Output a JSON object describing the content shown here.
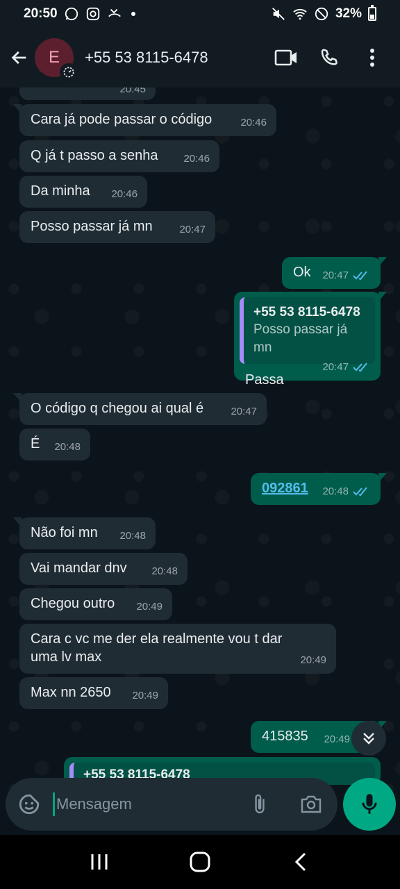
{
  "status_bar": {
    "time": "20:50",
    "battery": "32%",
    "icons": [
      "whatsapp-icon",
      "instagram-icon",
      "missed-call-icon",
      "mute-icon",
      "wifi-icon",
      "dnd-icon",
      "battery-icon"
    ]
  },
  "header": {
    "avatar_letter": "E",
    "contact_name": "+55 53 8115-6478",
    "actions": [
      "video-call-icon",
      "voice-call-icon",
      "more-options-icon"
    ]
  },
  "messages": [
    {
      "dir": "in",
      "text": "Cara já pode passar o código",
      "time": "20:46"
    },
    {
      "dir": "in",
      "text": "Q já t passo a senha",
      "time": "20:46"
    },
    {
      "dir": "in",
      "text": "Da minha",
      "time": "20:46"
    },
    {
      "dir": "in",
      "text": "Posso passar já mn",
      "time": "20:47"
    },
    {
      "dir": "out",
      "text": "Ok",
      "time": "20:47"
    },
    {
      "dir": "out",
      "reply_to_name": "+55 53 8115-6478",
      "reply_to_text": "Posso passar já mn",
      "text": "Passa",
      "time": "20:47"
    },
    {
      "dir": "in",
      "text": "O código q chegou ai qual é",
      "time": "20:47"
    },
    {
      "dir": "in",
      "text": "É",
      "time": "20:48"
    },
    {
      "dir": "out",
      "text": "092861",
      "time": "20:48"
    },
    {
      "dir": "in",
      "text": "Não foi mn",
      "time": "20:48"
    },
    {
      "dir": "in",
      "text": "Vai mandar dnv",
      "time": "20:48"
    },
    {
      "dir": "in",
      "text": "Chegou outro",
      "time": "20:49"
    },
    {
      "dir": "in",
      "text": "Cara c vc me der ela realmente vou t dar uma lv max",
      "time": "20:49"
    },
    {
      "dir": "in",
      "text": "Max nn 2650",
      "time": "20:49"
    },
    {
      "dir": "out",
      "text": "415835",
      "time": "20:49"
    },
    {
      "dir": "out",
      "reply_to_name": "+55 53 8115-6478",
      "text": ""
    }
  ],
  "partial_top_time": "20:45",
  "input": {
    "placeholder": "Mensagem"
  },
  "colors": {
    "background": "#0b141a",
    "incoming_bubble": "#202c33",
    "outgoing_bubble": "#005c4b",
    "accent": "#00a884",
    "read_ticks": "#53bdeb",
    "quote_bar": "#a78bfa"
  }
}
